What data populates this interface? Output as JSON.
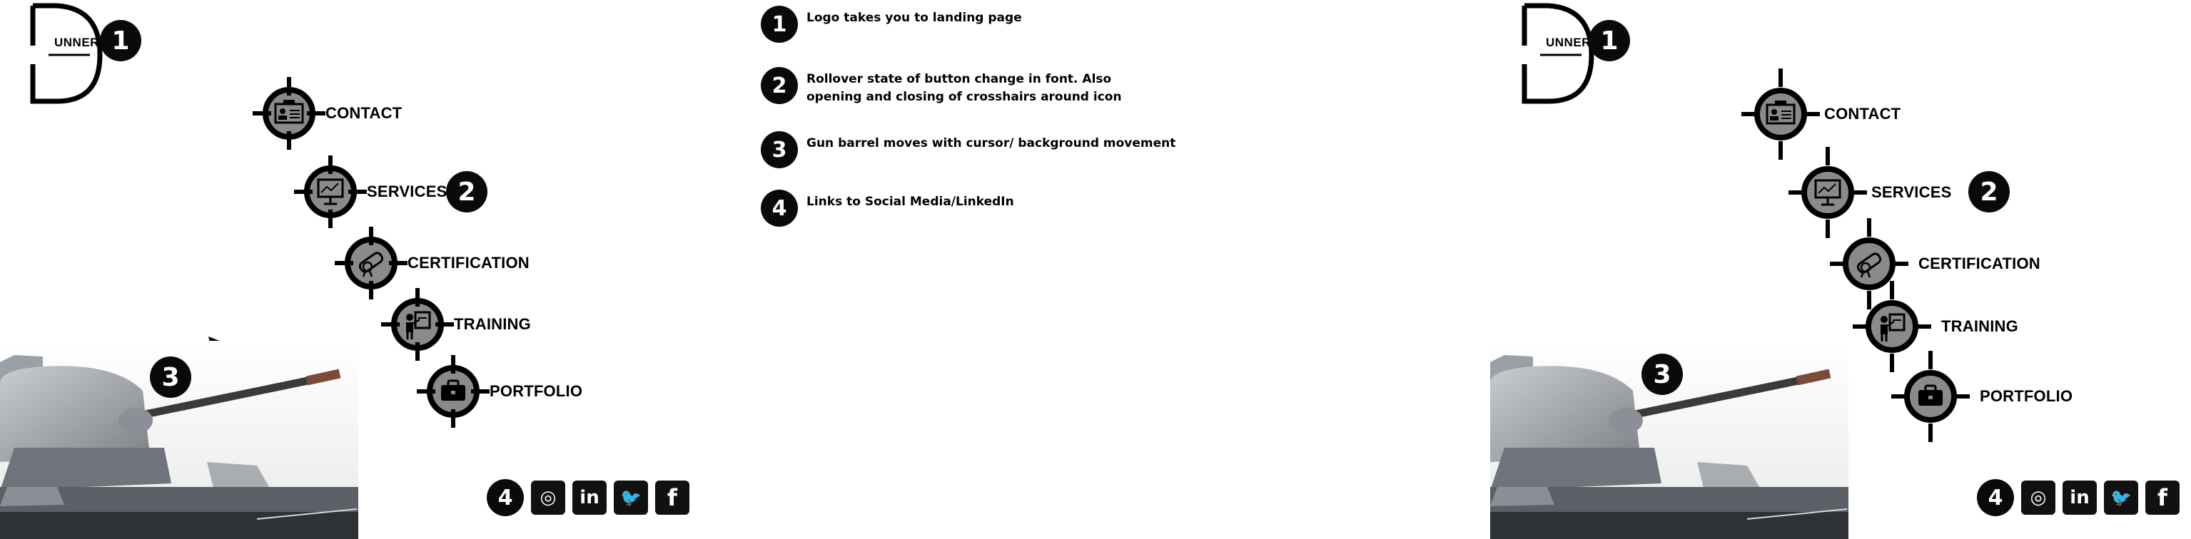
{
  "logo": {
    "text": "UNNER",
    "badge": "1"
  },
  "menu": [
    {
      "label": "CONTACT",
      "icon": "id-card-icon"
    },
    {
      "label": "SERVICES",
      "icon": "presentation-icon",
      "badge": "2"
    },
    {
      "label": "CERTIFICATION",
      "icon": "diploma-icon"
    },
    {
      "label": "TRAINING",
      "icon": "trainer-icon"
    },
    {
      "label": "PORTFOLIO",
      "icon": "briefcase-icon"
    }
  ],
  "scene": {
    "badge": "3"
  },
  "social": {
    "badge": "4",
    "icons": [
      {
        "name": "instagram-icon",
        "glyph": "◎"
      },
      {
        "name": "linkedin-icon",
        "glyph": "in"
      },
      {
        "name": "twitter-icon",
        "glyph": "🐦"
      },
      {
        "name": "facebook-icon",
        "glyph": "f"
      }
    ]
  },
  "notes": [
    {
      "num": "1",
      "text": "Logo takes you to landing page"
    },
    {
      "num": "2",
      "text": "Rollover state of button change in font. Also\nopening and closing of crosshairs around icon"
    },
    {
      "num": "3",
      "text": "Gun barrel moves with cursor/ background movement"
    },
    {
      "num": "4",
      "text": "Links to Social Media/LinkedIn"
    }
  ],
  "colors": {
    "ring": "#000000",
    "fill": "#8a8a8a",
    "badge": "#0a0a0a"
  }
}
